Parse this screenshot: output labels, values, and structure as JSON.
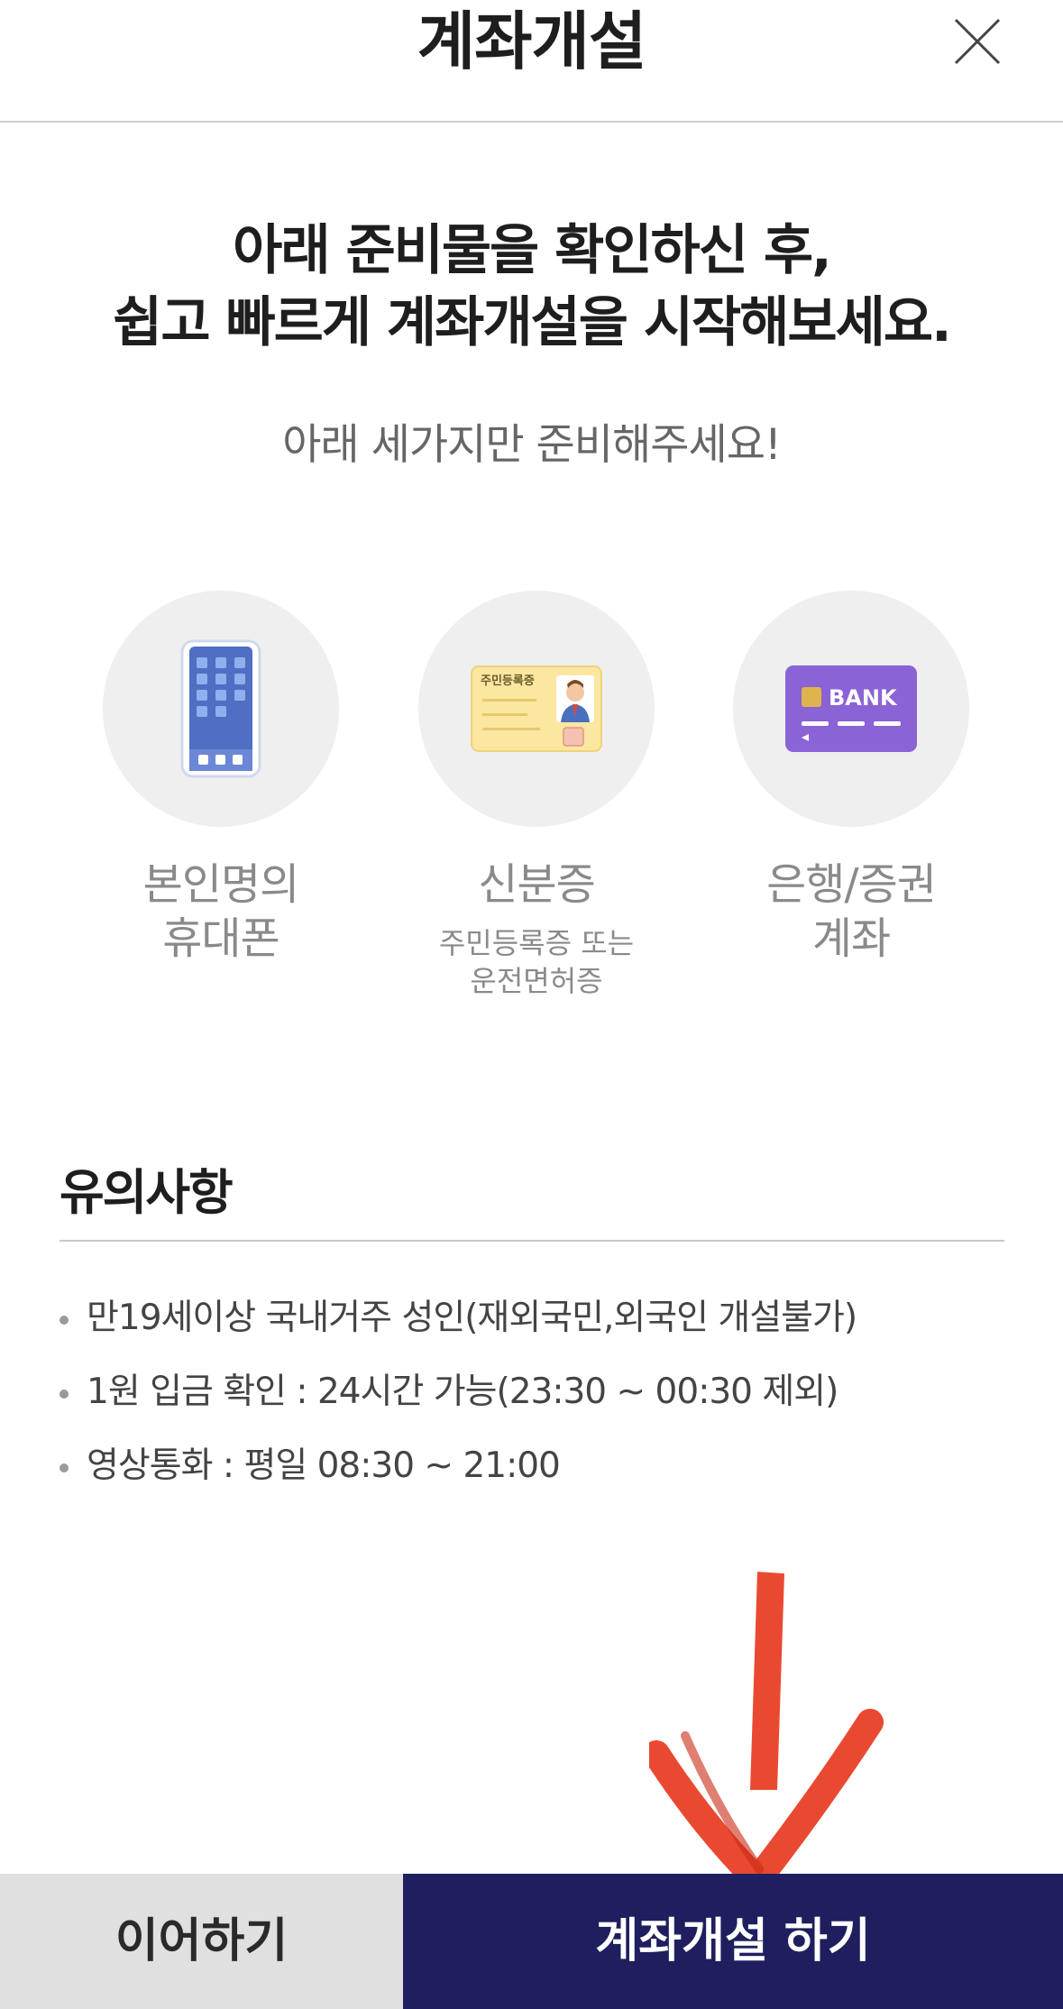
{
  "header": {
    "title": "계좌개설",
    "close_icon": "close-icon"
  },
  "intro": {
    "title_lines": [
      "아래 준비물을 확인하신 후,",
      "쉽고 빠르게 계좌개설을 시작해보세요."
    ],
    "subtitle": "아래 세가지만 준비해주세요!"
  },
  "items": [
    {
      "icon": "smartphone-icon",
      "label_lines": [
        "본인명의",
        "휴대폰"
      ]
    },
    {
      "icon": "id-card-icon",
      "card_text": "주민등록증",
      "label_lines": [
        "신분증"
      ],
      "note_lines": [
        "주민등록증 또는",
        "운전면허증"
      ]
    },
    {
      "icon": "bank-card-icon",
      "card_text": "BANK",
      "label_lines": [
        "은행/증권",
        "계좌"
      ]
    }
  ],
  "notice": {
    "title": "유의사항",
    "items": [
      "만19세이상 국내거주 성인(재외국민,외국인 개설불가)",
      "1원 입금 확인 : 24시간 가능(23:30 ~ 00:30 제외)",
      "영상통화 : 평일 08:30 ~ 21:00"
    ]
  },
  "footer": {
    "continue_label": "이어하기",
    "open_label": "계좌개설 하기"
  },
  "colors": {
    "primary_button": "#1f1f5f",
    "secondary_button": "#e0e0e0",
    "annotation_arrow": "#e8391f",
    "bank_card": "#8a63d6",
    "id_card": "#fbe7a0"
  }
}
